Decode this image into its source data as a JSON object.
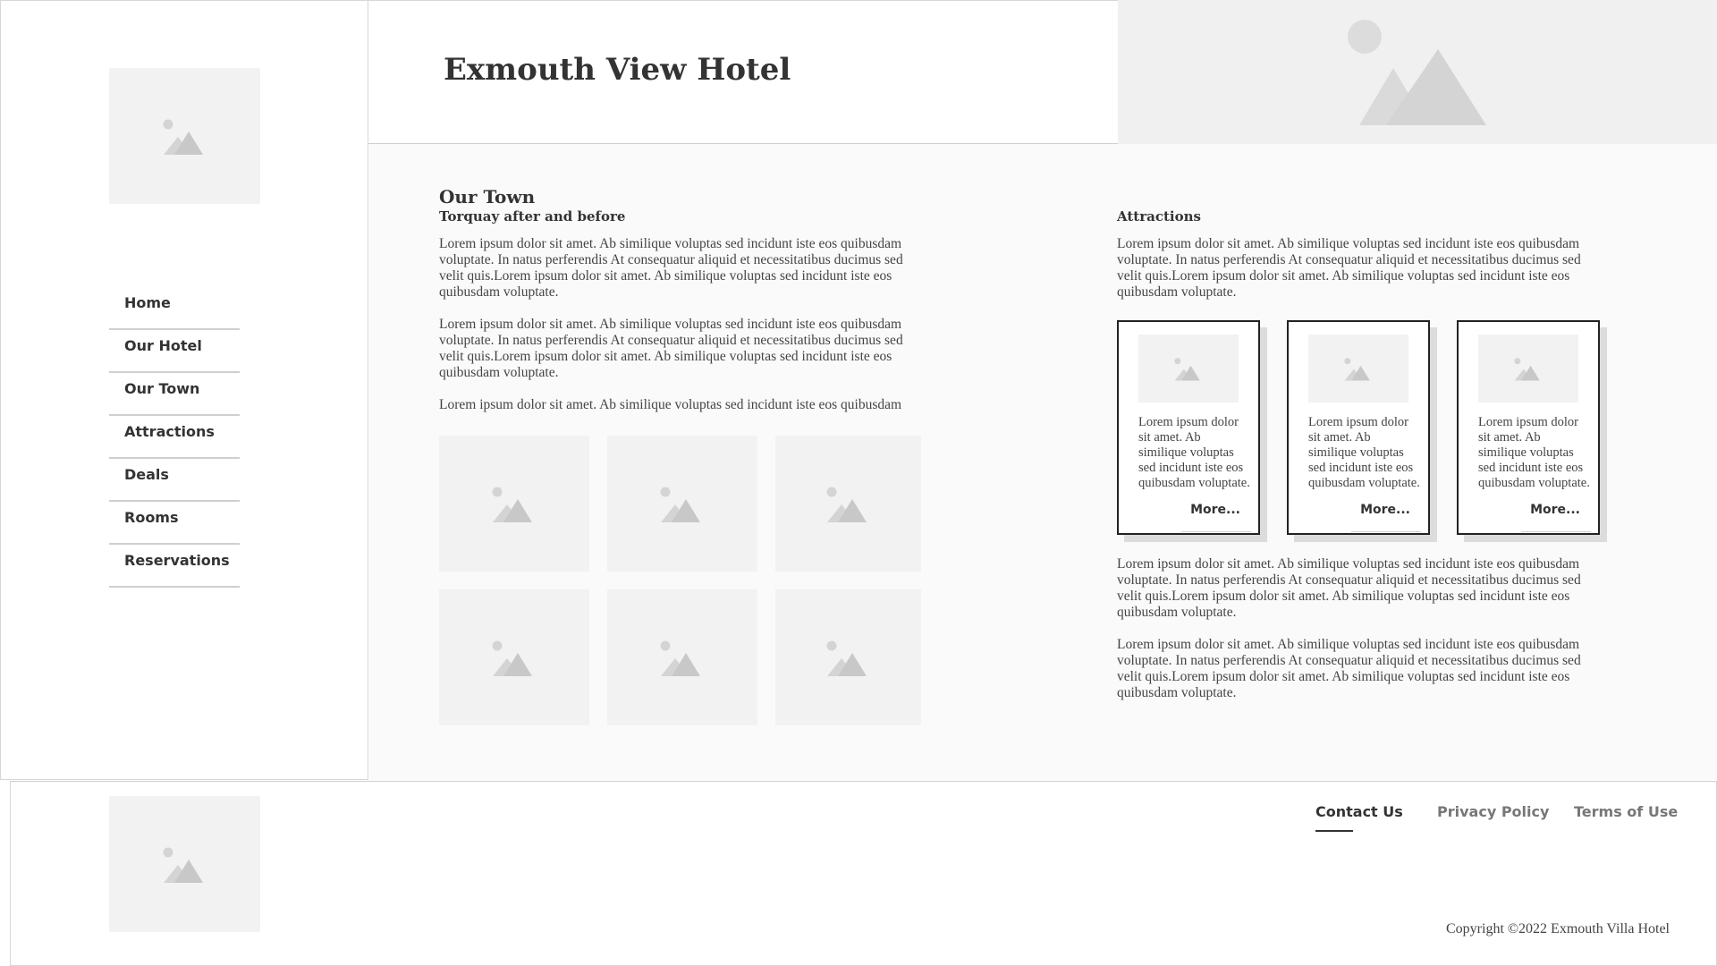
{
  "header": {
    "title": "Exmouth View Hotel"
  },
  "nav": {
    "items": [
      {
        "label": "Home"
      },
      {
        "label": "Our Hotel"
      },
      {
        "label": "Our Town"
      },
      {
        "label": "Attractions"
      },
      {
        "label": "Deals"
      },
      {
        "label": "Rooms"
      },
      {
        "label": "Reservations"
      }
    ]
  },
  "main": {
    "heading": "Our Town",
    "subheading": "Torquay after and before",
    "paragraphs": [
      "Lorem ipsum dolor sit amet. Ab similique voluptas sed incidunt iste eos quibusdam voluptate. In natus perferendis At consequatur aliquid et necessitatibus ducimus sed velit quis.Lorem ipsum dolor sit amet. Ab similique voluptas sed incidunt iste eos quibusdam voluptate.",
      "Lorem ipsum dolor sit amet. Ab similique voluptas sed incidunt iste eos quibusdam voluptate. In natus perferendis At consequatur aliquid et necessitatibus ducimus sed velit quis.Lorem ipsum dolor sit amet. Ab similique voluptas sed incidunt iste eos quibusdam voluptate.",
      "Lorem ipsum dolor sit amet. Ab similique voluptas sed incidunt iste eos quibusdam"
    ]
  },
  "attractions": {
    "heading": "Attractions",
    "intro": "Lorem ipsum dolor sit amet. Ab similique voluptas sed incidunt iste eos quibusdam voluptate. In natus perferendis At consequatur aliquid et necessitatibus ducimus sed velit quis.Lorem ipsum dolor sit amet. Ab similique voluptas sed incidunt iste eos quibusdam voluptate.",
    "cards": [
      {
        "text": "Lorem ipsum dolor sit amet. Ab similique voluptas sed incidunt iste eos quibusdam voluptate.",
        "more": "More..."
      },
      {
        "text": "Lorem ipsum dolor sit amet. Ab similique voluptas sed incidunt iste eos quibusdam voluptate.",
        "more": "More..."
      },
      {
        "text": "Lorem ipsum dolor sit amet. Ab similique voluptas sed incidunt iste eos quibusdam voluptate.",
        "more": "More..."
      }
    ],
    "paragraphs": [
      "Lorem ipsum dolor sit amet. Ab similique voluptas sed incidunt iste eos quibusdam voluptate. In natus perferendis At consequatur aliquid et necessitatibus ducimus sed velit quis.Lorem ipsum dolor sit amet. Ab similique voluptas sed incidunt iste eos quibusdam voluptate.",
      "Lorem ipsum dolor sit amet. Ab similique voluptas sed incidunt iste eos quibusdam voluptate. In natus perferendis At consequatur aliquid et necessitatibus ducimus sed velit quis.Lorem ipsum dolor sit amet. Ab similique voluptas sed incidunt iste eos quibusdam voluptate."
    ]
  },
  "footer": {
    "links": [
      {
        "label": "Contact Us"
      },
      {
        "label": "Privacy Policy"
      },
      {
        "label": "Terms of Use"
      }
    ],
    "copyright": "Copyright ©2022 Exmouth Villa Hotel"
  },
  "colors": {
    "placeholder": "#f2f2f2",
    "text": "#333333",
    "border": "#d7d7d7"
  }
}
